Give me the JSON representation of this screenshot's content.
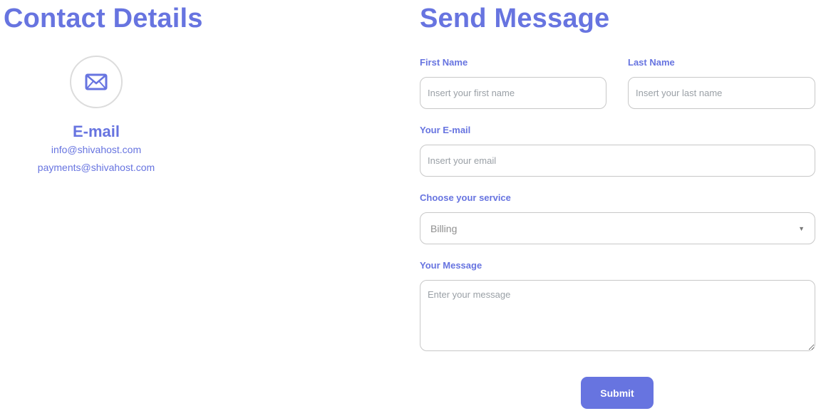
{
  "contact": {
    "title": "Contact Details",
    "card": {
      "icon": "envelope-icon",
      "heading": "E-mail",
      "lines": [
        "info@shivahost.com",
        "payments@shivahost.com"
      ]
    }
  },
  "form": {
    "title": "Send Message",
    "first_name": {
      "label": "First Name",
      "placeholder": "Insert your first name",
      "value": ""
    },
    "last_name": {
      "label": "Last Name",
      "placeholder": "Insert your last name",
      "value": ""
    },
    "email": {
      "label": "Your E-mail",
      "placeholder": "Insert your email",
      "value": ""
    },
    "service": {
      "label": "Choose your service",
      "selected": "Billing",
      "icon": "chevron-down-icon"
    },
    "message": {
      "label": "Your Message",
      "placeholder": "Enter your message",
      "value": ""
    },
    "submit_label": "Submit"
  },
  "colors": {
    "accent": "#6774e0",
    "border": "#c8c8c8",
    "circle_border": "#dcdcdc"
  }
}
